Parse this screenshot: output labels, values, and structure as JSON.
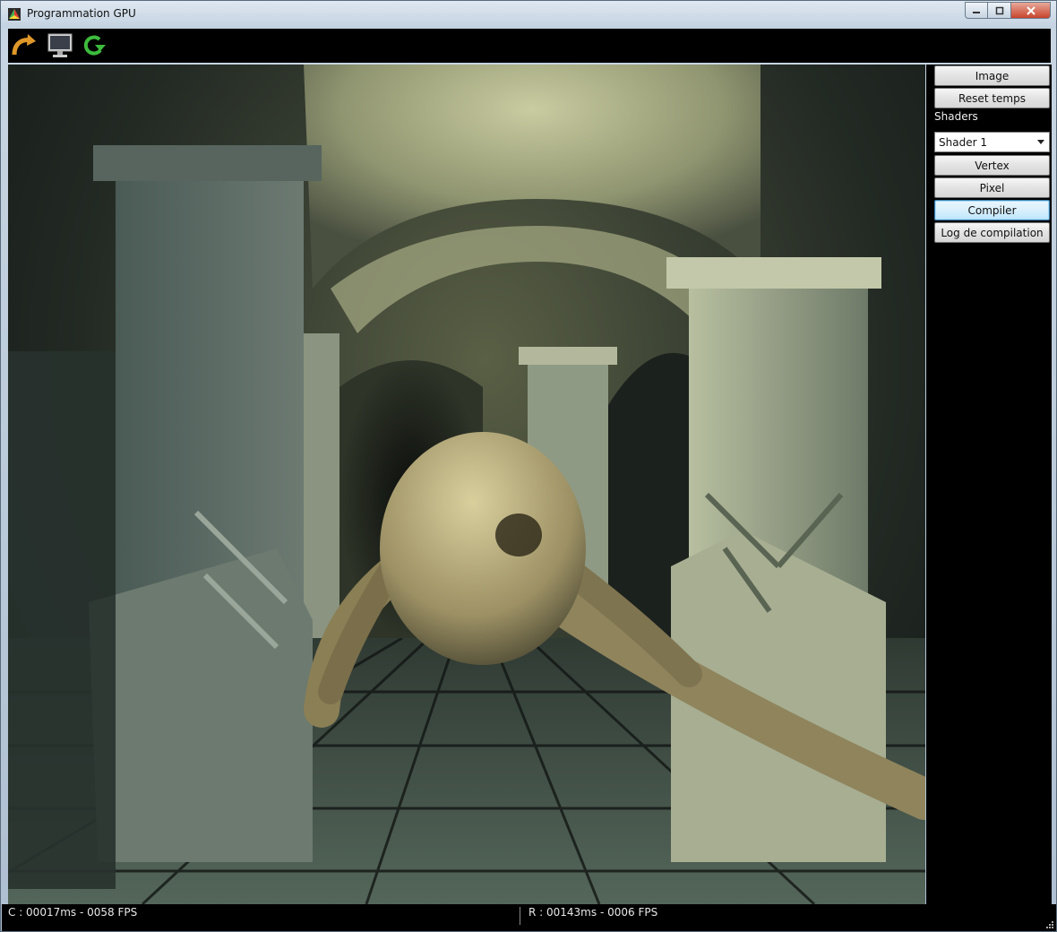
{
  "window": {
    "title": "Programmation GPU"
  },
  "toolbar": {
    "icons": [
      "refresh-arrow-icon",
      "monitor-icon",
      "green-cycle-icon"
    ]
  },
  "panel": {
    "image_button": "Image",
    "reset_button": "Reset temps",
    "shaders_label": "Shaders",
    "shader_select": "Shader 1",
    "vertex_button": "Vertex",
    "pixel_button": "Pixel",
    "compile_button": "Compiler",
    "log_button": "Log de compilation"
  },
  "status": {
    "left": "C : 00017ms - 0058 FPS",
    "right": "R : 00143ms - 0006 FPS"
  },
  "colors": {
    "accent_focus": "#3c7fb1",
    "viewport_tint": "#5a6045"
  }
}
